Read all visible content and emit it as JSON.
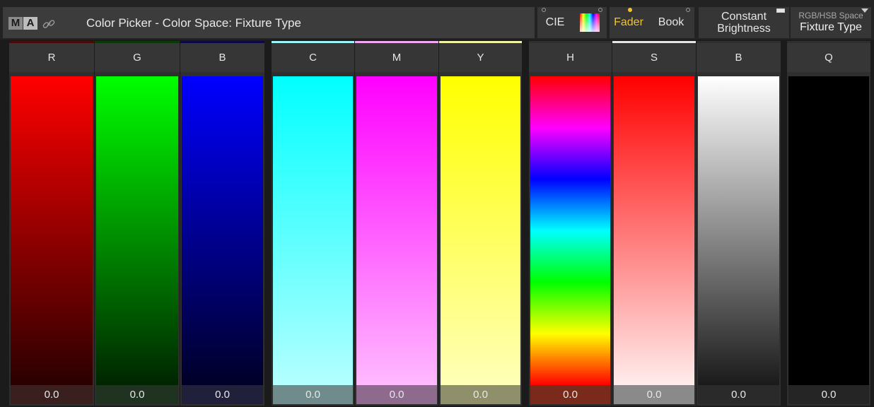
{
  "app": {
    "logo_letters": [
      "M",
      "A"
    ],
    "window_title": "Color Picker - Color Space: Fixture Type"
  },
  "toolbar": {
    "cie_label": "CIE",
    "fader_label": "Fader",
    "book_label": "Book",
    "constant_brightness_line1": "Constant",
    "constant_brightness_line2": "Brightness",
    "space_label": "RGB/HSB Space",
    "space_value": "Fixture Type",
    "active_mode_color": "#f2c230"
  },
  "faders": [
    {
      "label": "R",
      "value": "0.0",
      "accent": "#4a0a0a",
      "gradient": [
        "#ff0000",
        "#2a0000"
      ],
      "value_bg": "#3a1f1f"
    },
    {
      "label": "G",
      "value": "0.0",
      "accent": "#0a3a0a",
      "gradient": [
        "#00ff00",
        "#002500"
      ],
      "value_bg": "#203320"
    },
    {
      "label": "B",
      "value": "0.0",
      "accent": "#0a0a4a",
      "gradient": [
        "#0000ff",
        "#000028"
      ],
      "value_bg": "#20203a"
    },
    {
      "label": "C",
      "value": "0.0",
      "accent": "#9ef4f4",
      "gradient": [
        "#00ffff",
        "#b4ffff"
      ],
      "value_bg": "#6f8b8b"
    },
    {
      "label": "M",
      "value": "0.0",
      "accent": "#f2a8f2",
      "gradient": [
        "#ff00ff",
        "#ffbaff"
      ],
      "value_bg": "#8f6a8f"
    },
    {
      "label": "Y",
      "value": "0.0",
      "accent": "#f2f2a8",
      "gradient": [
        "#ffff00",
        "#ffffb8"
      ],
      "value_bg": "#8f8f6a"
    },
    {
      "label": "H",
      "value": "0.0",
      "accent": "#2f2f2f",
      "gradient": [
        "#ff0000",
        "#ff00ff",
        "#0000ff",
        "#00ffff",
        "#00ff00",
        "#ffff00",
        "#ff0000"
      ],
      "value_bg": "#7a2a1a"
    },
    {
      "label": "S",
      "value": "0.0",
      "accent": "#e6e6e6",
      "gradient": [
        "#ff0000",
        "#ffecec"
      ],
      "value_bg": "#8a8a8a"
    },
    {
      "label": "B",
      "value": "0.0",
      "accent": "#2f2f2f",
      "gradient": [
        "#ffffff",
        "#1a1a1a"
      ],
      "value_bg": "#2a2a2a"
    },
    {
      "label": "Q",
      "value": "0.0",
      "accent": "#2f2f2f",
      "gradient": [
        "#000000",
        "#000000"
      ],
      "value_bg": "#252525"
    }
  ]
}
